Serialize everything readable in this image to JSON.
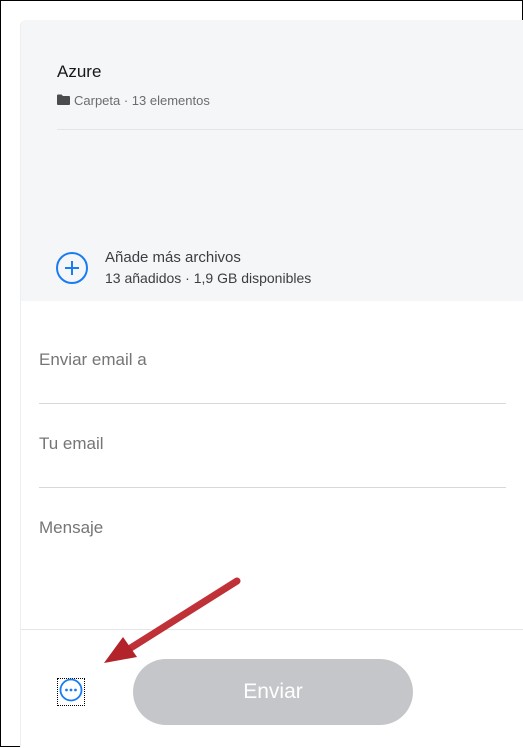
{
  "transfer": {
    "title": "Azure",
    "folder_icon": "folder-icon",
    "meta": "Carpeta · 13 elementos"
  },
  "add_files": {
    "icon": "plus-circle-icon",
    "title": "Añade más archivos",
    "subtitle": "13 añadidos · 1,9 GB disponibles"
  },
  "form": {
    "email_to_placeholder": "Enviar email a",
    "your_email_placeholder": "Tu email",
    "message_placeholder": "Mensaje"
  },
  "footer": {
    "more_icon": "more-options-icon",
    "send_label": "Enviar"
  },
  "annotation": {
    "arrow_icon": "red-arrow-icon",
    "color": "#c1272d"
  },
  "colors": {
    "accent": "#1a7cf5",
    "button_disabled": "#c4c6c9",
    "panel_bg": "#f5f6f8"
  }
}
